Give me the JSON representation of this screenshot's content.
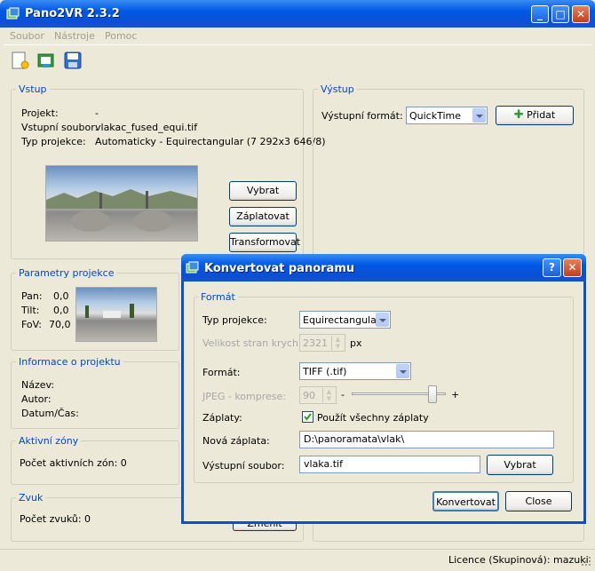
{
  "window": {
    "title": "Pano2VR 2.3.2"
  },
  "menu": {
    "items": [
      "Soubor",
      "Nástroje",
      "Pomoc"
    ]
  },
  "toolbar": {
    "icons": [
      "new-project-icon",
      "open-project-icon",
      "save-icon"
    ]
  },
  "input_group": {
    "legend": "Vstup",
    "project_label": "Projekt:",
    "project_value": "-",
    "input_file_label": "Vstupní soubor:",
    "input_file_value": "vlakac_fused_equi.tif",
    "projection_label": "Typ projekce:",
    "projection_value": "Automaticky - Equirectangular (7 292x3 646/8)",
    "buttons": {
      "select": "Vybrat",
      "patch": "Záplatovat",
      "transform": "Transformovat"
    }
  },
  "output_group": {
    "legend": "Výstup",
    "format_label": "Výstupní formát:",
    "format_value": "QuickTime",
    "add_button": "Přidat"
  },
  "params_group": {
    "legend": "Parametry projekce",
    "pan_label": "Pan:",
    "pan_value": "0,0",
    "tilt_label": "Tilt:",
    "tilt_value": "0,0",
    "fov_label": "FoV:",
    "fov_value": "70,0"
  },
  "info_group": {
    "legend": "Informace o projektu",
    "name_label": "Název:",
    "author_label": "Autor:",
    "datetime_label": "Datum/Čas:"
  },
  "zones_group": {
    "legend": "Aktivní zóny",
    "count_label": "Počet aktivních zón: 0"
  },
  "sound_group": {
    "legend": "Zvuk",
    "count_label": "Počet zvuků: 0",
    "button_partial": "Změnit"
  },
  "status": {
    "license": "Licence (Skupinová): mazuki"
  },
  "dialog": {
    "title": "Konvertovat panoramu",
    "format_legend": "Formát",
    "projection_type_label": "Typ projekce:",
    "projection_type_value": "Equirectangular",
    "cube_size_label": "Velikost stran krychle:",
    "cube_size_value": "2321",
    "cube_size_unit": "px",
    "format_label": "Formát:",
    "format_value": "TIFF (.tif)",
    "jpeg_label": "JPEG - komprese:",
    "jpeg_value": "90",
    "jpeg_minus": "-",
    "jpeg_plus": "+",
    "jpeg_slider_level": 0.9,
    "patches_label": "Záplaty:",
    "patches_checkbox_label": "Použít všechny záplaty",
    "patches_checked": true,
    "new_patch_label": "Nová záplata:",
    "new_patch_value": "D:\\panoramata\\vlak\\",
    "output_file_label": "Výstupní soubor:",
    "output_file_value": "vlaka.tif",
    "select_button": "Vybrat",
    "convert_button": "Konvertovat",
    "close_button": "Close"
  },
  "colors": {
    "titlebar": "#0058e6",
    "legend": "#0046d5",
    "face": "#ece9d8"
  }
}
